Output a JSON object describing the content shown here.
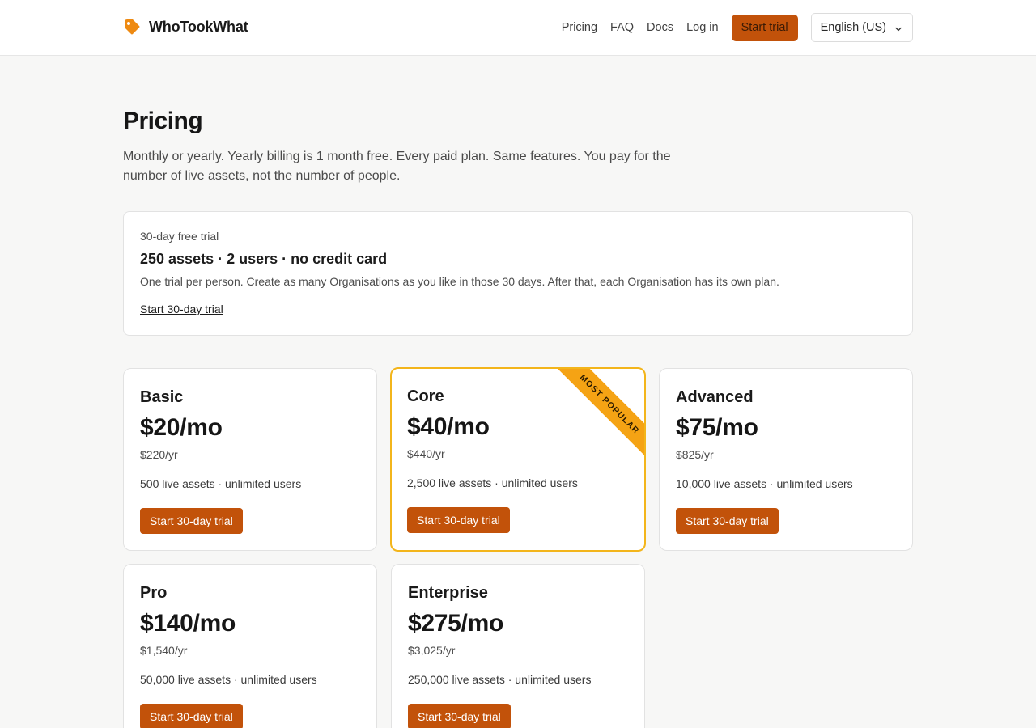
{
  "header": {
    "brand": "WhoTookWhat",
    "nav": [
      "Pricing",
      "FAQ",
      "Docs",
      "Log in"
    ],
    "cta": "Start trial",
    "language": "English (US)"
  },
  "intro": {
    "title": "Pricing",
    "lede": "Monthly or yearly. Yearly billing is 1 month free. Every paid plan. Same features. You pay for the number of live assets, not the number of people."
  },
  "trial": {
    "kicker": "30-day free trial",
    "headline": "250 assets · 2 users · no credit card",
    "note": "One trial per person. Create as many Organisations as you like in those 30 days. After that, each Organisation has its own plan.",
    "link": "Start 30-day trial"
  },
  "plans": [
    {
      "name": "Basic",
      "price": "$20/mo",
      "yearly": "$220/yr",
      "limits": "500 live assets · unlimited users",
      "cta": "Start 30-day trial"
    },
    {
      "name": "Core",
      "price": "$40/mo",
      "yearly": "$440/yr",
      "limits": "2,500 live assets · unlimited users",
      "cta": "Start 30-day trial",
      "badge": "MOST POPULAR"
    },
    {
      "name": "Advanced",
      "price": "$75/mo",
      "yearly": "$825/yr",
      "limits": "10,000 live assets · unlimited users",
      "cta": "Start 30-day trial"
    },
    {
      "name": "Pro",
      "price": "$140/mo",
      "yearly": "$1,540/yr",
      "limits": "50,000 live assets · unlimited users",
      "cta": "Start 30-day trial"
    },
    {
      "name": "Enterprise",
      "price": "$275/mo",
      "yearly": "$3,025/yr",
      "limits": "250,000 live assets · unlimited users",
      "cta": "Start 30-day trial"
    }
  ],
  "colors": {
    "accent": "#c2520a",
    "featured_border": "#f3b51b",
    "ribbon": "#f5a314"
  },
  "icons": {
    "brand": "tag-icon",
    "language": "chevron-down-icon"
  }
}
